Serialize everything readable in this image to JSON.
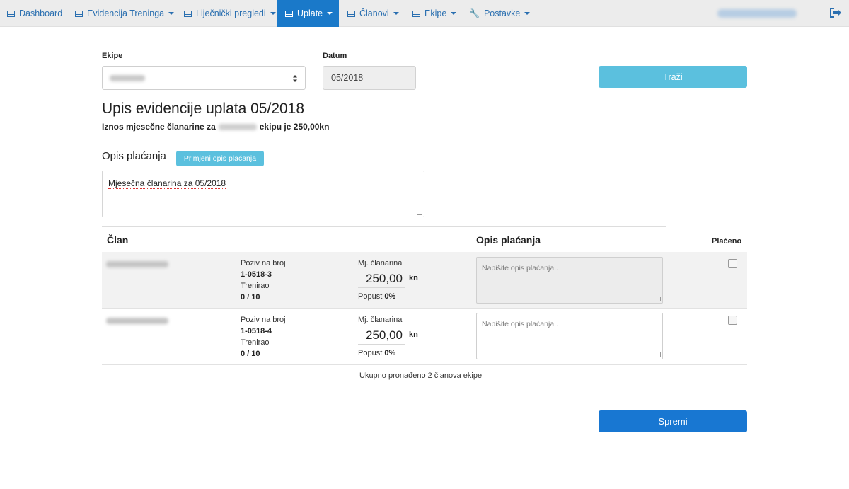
{
  "navbar": {
    "items": [
      {
        "label": "Dashboard",
        "icon": "list-icon",
        "dropdown": false,
        "active": false
      },
      {
        "label": "Evidencija Treninga",
        "icon": "list-icon",
        "dropdown": true,
        "active": false
      },
      {
        "label": "Liječnički pregledi",
        "icon": "list-icon",
        "dropdown": true,
        "active": false
      },
      {
        "label": "Uplate",
        "icon": "list-icon",
        "dropdown": true,
        "active": true
      },
      {
        "label": "Članovi",
        "icon": "list-icon",
        "dropdown": true,
        "active": false
      },
      {
        "label": "Ekipe",
        "icon": "list-icon",
        "dropdown": true,
        "active": false
      },
      {
        "label": "Postavke",
        "icon": "wrench-icon",
        "dropdown": true,
        "active": false
      }
    ],
    "logout_icon": "logout-icon",
    "accent_color": "#1a79c9"
  },
  "filters": {
    "team_label": "Ekipe",
    "date_label": "Datum",
    "date_value": "05/2018",
    "search_button": "Traži"
  },
  "header": {
    "title": "Upis evidencije uplata 05/2018",
    "subline_prefix": "Iznos mjesečne članarine za",
    "subline_suffix": "ekipu je 250,00kn"
  },
  "payment_description": {
    "heading": "Opis plaćanja",
    "apply_button": "Primjeni opis plaćanja",
    "value": "Mjesečna članarina za 05/2018"
  },
  "table": {
    "col_member": "Član",
    "col_description": "Opis plaćanja",
    "col_paid": "Plaćeno",
    "rows": [
      {
        "ref_label": "Poziv na broj",
        "ref_value": "1-0518-3",
        "trained_label": "Trenirao",
        "trained_value": "0 / 10",
        "fee_label": "Mj. članarina",
        "fee_amount": "250,00",
        "currency": "kn",
        "discount_label": "Popust",
        "discount_value": "0%",
        "desc_placeholder": "Napišite opis plaćanja..",
        "paid": false
      },
      {
        "ref_label": "Poziv na broj",
        "ref_value": "1-0518-4",
        "trained_label": "Trenirao",
        "trained_value": "0 / 10",
        "fee_label": "Mj. članarina",
        "fee_amount": "250,00",
        "currency": "kn",
        "discount_label": "Popust",
        "discount_value": "0%",
        "desc_placeholder": "Napišite opis plaćanja..",
        "paid": false
      }
    ],
    "total_text": "Ukupno pronađeno 2 članova ekipe"
  },
  "save_button": "Spremi"
}
